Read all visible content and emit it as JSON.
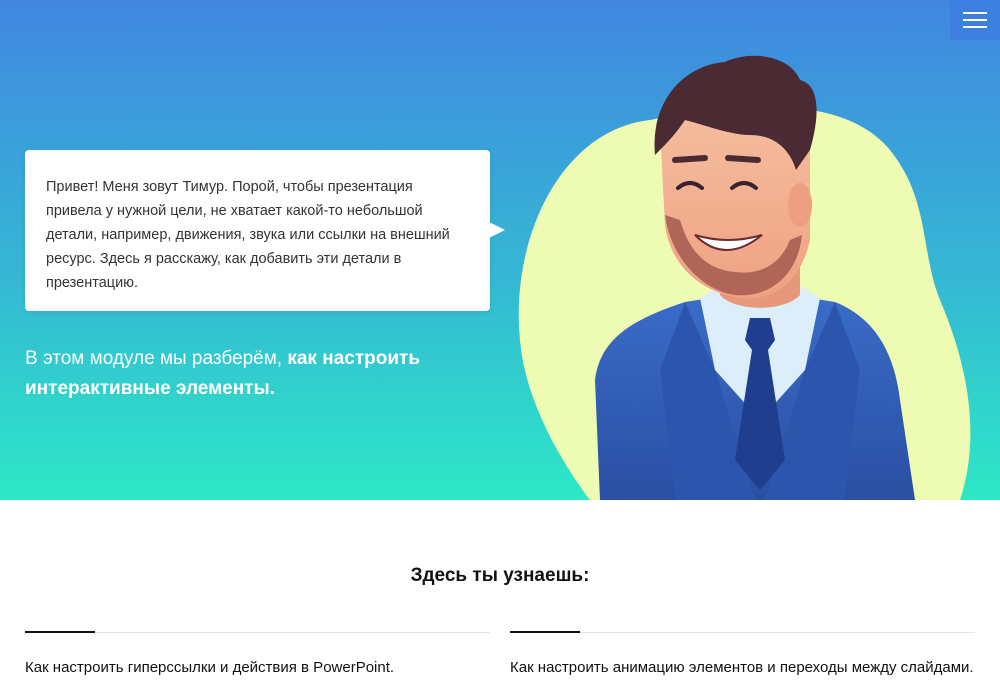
{
  "header": {
    "menu_icon": "hamburger-menu-icon"
  },
  "hero": {
    "speech_bubble_text": "Привет! Меня зовут Тимур. Порой, чтобы презентация привела у нужной цели, не хватает какой-то небольшой детали, например, движения, звука или ссылки на внешний ресурс. Здесь я расскажу, как добавить эти детали в презентацию.",
    "module_text_regular": "В этом модуле мы разберём, ",
    "module_text_bold": "как настроить интерактивные элементы.",
    "character_image": "smiling-man-illustration",
    "colors": {
      "gradient_top": "#4187e0",
      "gradient_bottom": "#2de8c6",
      "blob": "#eefbb2",
      "suit": "#2f5bb3",
      "tie": "#1f3f8e",
      "hair": "#4a2a33",
      "skin": "#f3b796"
    }
  },
  "learn_section": {
    "title": "Здесь ты узнаешь:",
    "items": [
      {
        "text": "Как настроить гиперссылки и действия в PowerPoint."
      },
      {
        "text": "Как настроить анимацию элементов и переходы между слайдами."
      }
    ]
  }
}
